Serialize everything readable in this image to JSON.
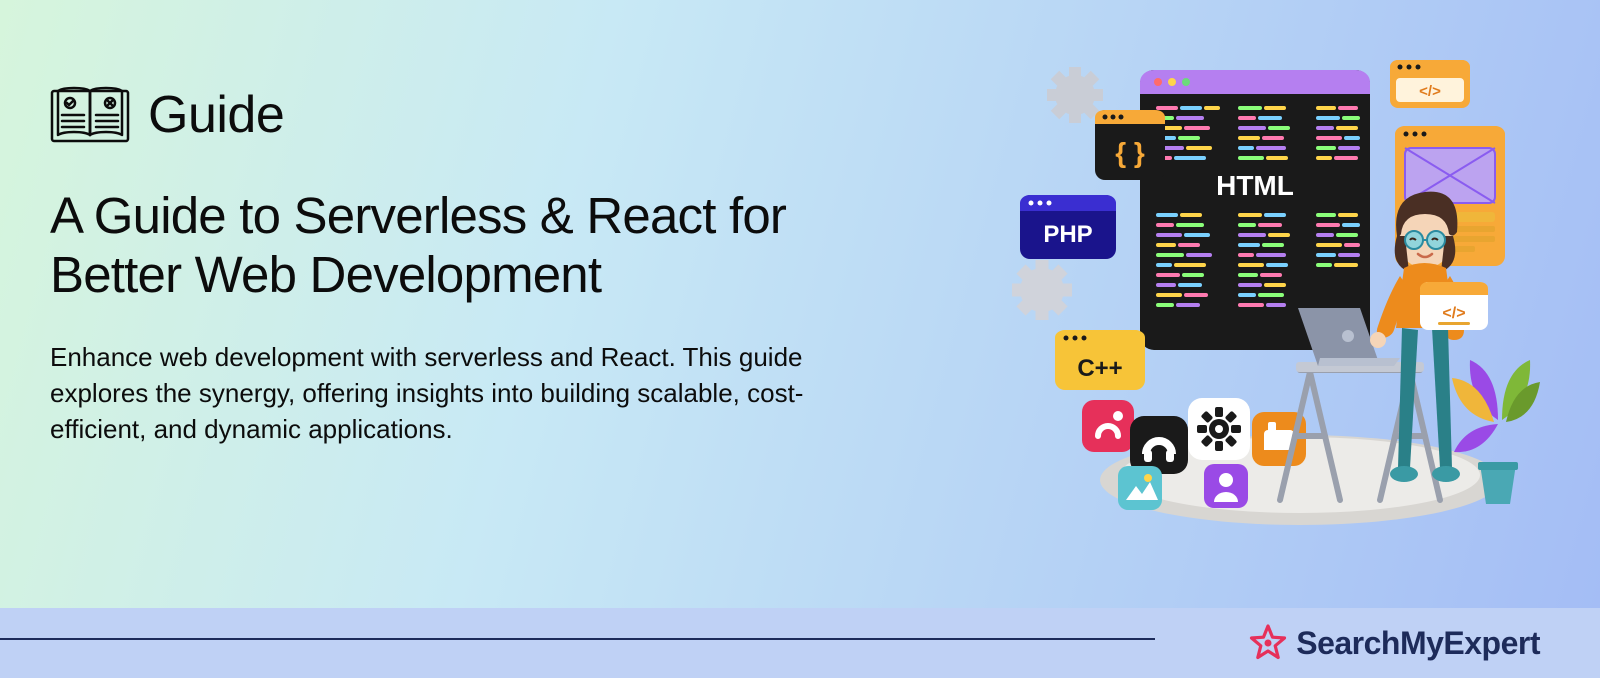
{
  "header": {
    "label": "Guide"
  },
  "main": {
    "title": "A Guide to Serverless & React for Better Web Development",
    "description": "Enhance web development with serverless and React. This guide explores the synergy, offering insights into building scalable, cost-efficient, and dynamic applications."
  },
  "illustration": {
    "badges": [
      "PHP",
      "C++",
      "HTML",
      "{ }",
      "</>"
    ]
  },
  "footer": {
    "brand": "SearchMyExpert"
  },
  "colors": {
    "text": "#0c0c0c",
    "brand": "#1d2b5a",
    "star": "#e6305a",
    "footerBg": "#bfd1f5"
  }
}
